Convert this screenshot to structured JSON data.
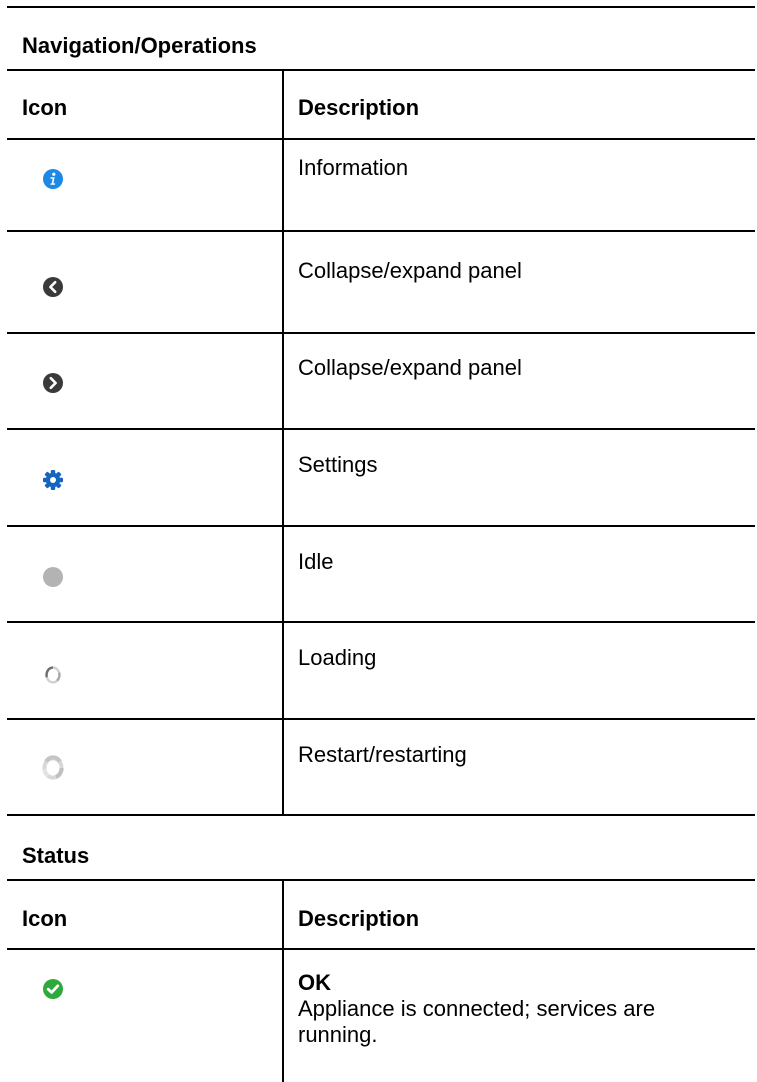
{
  "sections": [
    {
      "title": "Navigation/Operations",
      "header": {
        "icon": "Icon",
        "description": "Description"
      },
      "rows": [
        {
          "icon": "info-icon",
          "description": "Information"
        },
        {
          "icon": "collapse-left-icon",
          "description": "Collapse/expand panel"
        },
        {
          "icon": "expand-right-icon",
          "description": "Collapse/expand panel"
        },
        {
          "icon": "gear-icon",
          "description": "Settings"
        },
        {
          "icon": "idle-dot-icon",
          "description": "Idle"
        },
        {
          "icon": "loading-spinner-icon",
          "description": "Loading"
        },
        {
          "icon": "restart-spinner-icon",
          "description": "Restart/restarting"
        }
      ]
    },
    {
      "title": "Status",
      "header": {
        "icon": "Icon",
        "description": "Description"
      },
      "rows": [
        {
          "icon": "ok-check-icon",
          "title": "OK",
          "description": "Appliance is connected; services are running."
        }
      ]
    }
  ],
  "colors": {
    "info_blue": "#1e88e5",
    "gear_blue": "#1565c0",
    "dark_gray": "#3a3a3a",
    "idle_gray": "#b3b3b3",
    "ok_green": "#2eaa3c"
  }
}
